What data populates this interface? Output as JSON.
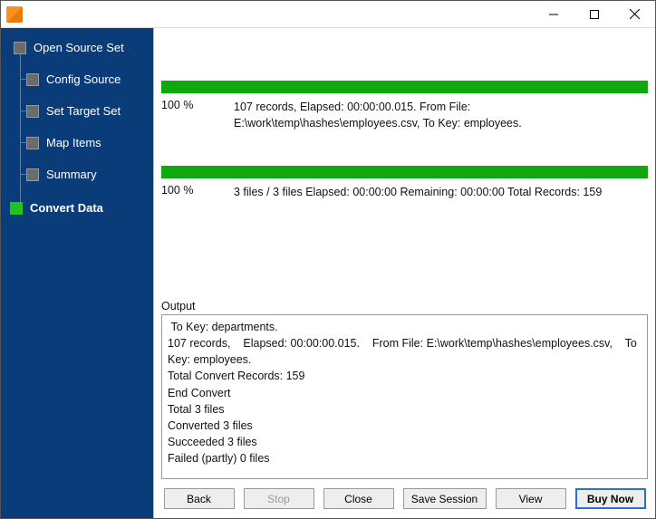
{
  "window": {
    "title": ""
  },
  "sidebar": {
    "items": [
      {
        "label": "Open Source Set",
        "active": false
      },
      {
        "label": "Config Source",
        "active": false
      },
      {
        "label": "Set Target Set",
        "active": false
      },
      {
        "label": "Map Items",
        "active": false
      },
      {
        "label": "Summary",
        "active": false
      },
      {
        "label": "Convert Data",
        "active": true
      }
    ]
  },
  "progress": {
    "file": {
      "percent": "100 %",
      "details": "107 records,    Elapsed: 00:00:00.015.    From File: E:\\work\\temp\\hashes\\employees.csv,    To Key: employees."
    },
    "overall": {
      "percent": "100 %",
      "details": "3 files / 3 files    Elapsed: 00:00:00    Remaining: 00:00:00    Total Records: 159"
    }
  },
  "output": {
    "title": "Output",
    "log": " To Key: departments.\n107 records,    Elapsed: 00:00:00.015.    From File: E:\\work\\temp\\hashes\\employees.csv,    To Key: employees.\nTotal Convert Records: 159\nEnd Convert\nTotal 3 files\nConverted 3 files\nSucceeded 3 files\nFailed (partly) 0 files"
  },
  "buttons": {
    "back": "Back",
    "stop": "Stop",
    "close": "Close",
    "save_session": "Save Session",
    "view": "View",
    "buy_now": "Buy Now"
  }
}
